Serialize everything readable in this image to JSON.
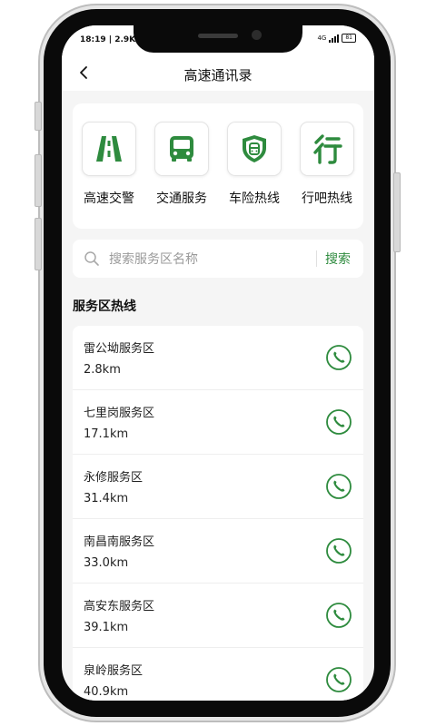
{
  "status_bar": {
    "time": "18:19 | 2.9K",
    "network": "4G",
    "battery": "81"
  },
  "header": {
    "title": "高速通讯录"
  },
  "shortcuts": [
    {
      "label": "高速交警",
      "icon": "highway-road-icon"
    },
    {
      "label": "交通服务",
      "icon": "bus-icon"
    },
    {
      "label": "车险热线",
      "icon": "car-shield-icon"
    },
    {
      "label": "行吧热线",
      "icon": "xing-character-icon"
    }
  ],
  "search": {
    "placeholder": "搜索服务区名称",
    "button_label": "搜索"
  },
  "section": {
    "title": "服务区热线"
  },
  "service_areas": [
    {
      "name": "雷公坳服务区",
      "distance": "2.8km"
    },
    {
      "name": "七里岗服务区",
      "distance": "17.1km"
    },
    {
      "name": "永修服务区",
      "distance": "31.4km"
    },
    {
      "name": "南昌南服务区",
      "distance": "33.0km"
    },
    {
      "name": "高安东服务区",
      "distance": "39.1km"
    },
    {
      "name": "泉岭服务区",
      "distance": "40.9km"
    }
  ],
  "colors": {
    "accent": "#2e8b3e",
    "background": "#f5f5f5"
  }
}
